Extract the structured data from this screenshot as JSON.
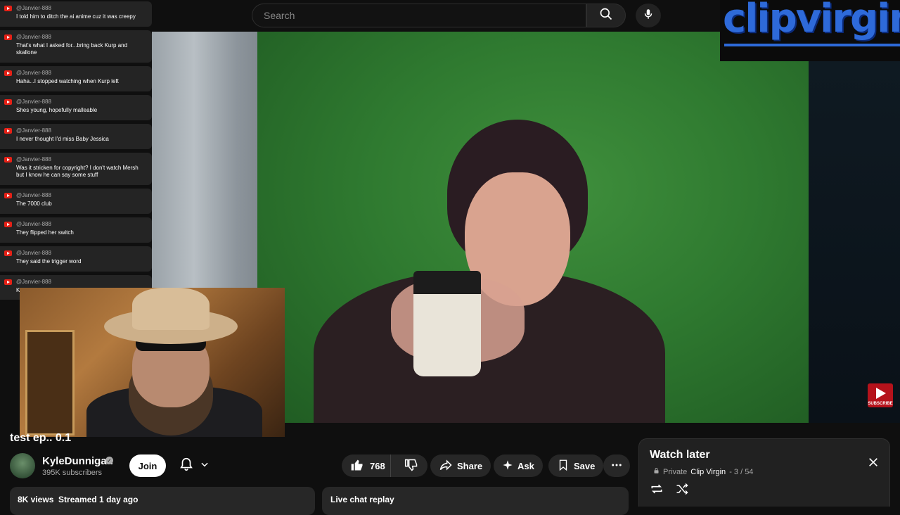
{
  "header": {
    "search_placeholder": "Search"
  },
  "logo": {
    "text": "clipvirgin"
  },
  "chat": {
    "messages": [
      {
        "user": "@Janvier-888",
        "text": "I told him to ditch the ai anime cuz it was creepy"
      },
      {
        "user": "@Janvier-888",
        "text": "That's what I asked for...bring back Kurp and skallone"
      },
      {
        "user": "@Janvier-888",
        "text": "Haha...I stopped watching when Kurp left"
      },
      {
        "user": "@Janvier-888",
        "text": "Shes young, hopefully malleable"
      },
      {
        "user": "@Janvier-888",
        "text": "I never thought I'd miss Baby Jessica"
      },
      {
        "user": "@Janvier-888",
        "text": "Was it stricken for copyright? I don't watch Mersh but I know he can say some stuff"
      },
      {
        "user": "@Janvier-888",
        "text": "The 7000 club"
      },
      {
        "user": "@Janvier-888",
        "text": "They flipped her switch"
      },
      {
        "user": "@Janvier-888",
        "text": "They said the trigger word"
      },
      {
        "user": "@Janvier-888",
        "text": "Ki"
      }
    ]
  },
  "overlay": {
    "subscribe_label": "SUBSCRIBE"
  },
  "video": {
    "title": "test ep.. 0.1"
  },
  "channel": {
    "name": "KyleDunnigan",
    "subscribers": "395K subscribers",
    "join_label": "Join"
  },
  "actions": {
    "like_count": "768",
    "share_label": "Share",
    "ask_label": "Ask",
    "save_label": "Save"
  },
  "stats": {
    "text": "8K views  Streamed 1 day ago"
  },
  "live_chat": {
    "label": "Live chat replay"
  },
  "playlist": {
    "title": "Watch later",
    "privacy": "Private",
    "owner": "Clip Virgin",
    "position": "- 3 / 54"
  }
}
